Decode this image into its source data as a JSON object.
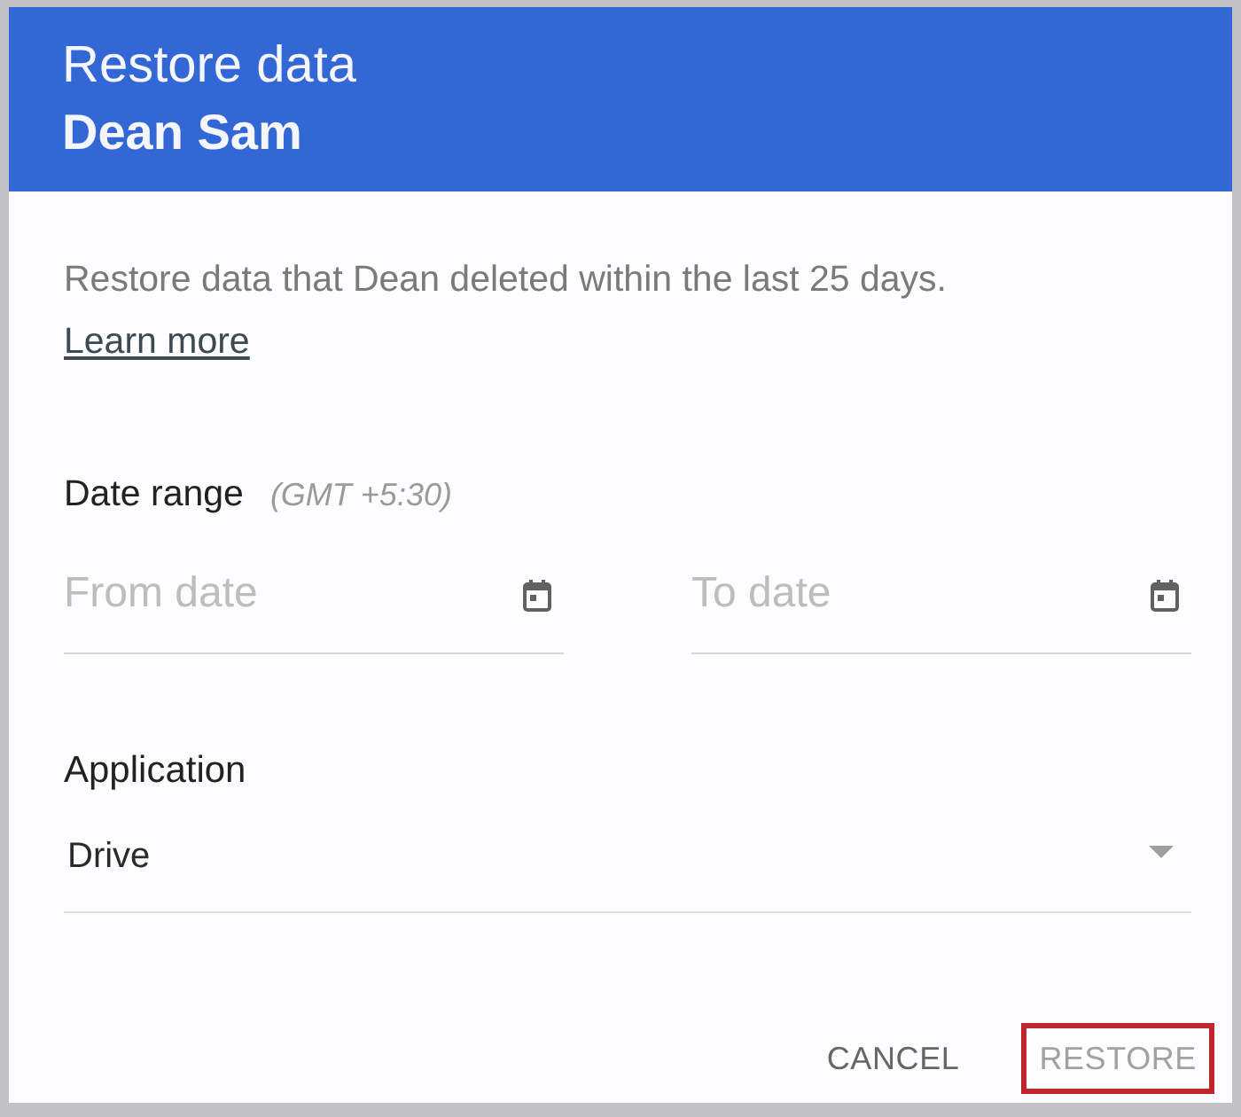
{
  "dialog": {
    "title": "Restore data",
    "subtitle": "Dean Sam"
  },
  "description": {
    "text": "Restore data that Dean deleted within the last 25 days.",
    "link": "Learn more"
  },
  "date_range": {
    "label": "Date range",
    "timezone": "(GMT +5:30)",
    "fields": [
      {
        "placeholder": "From date"
      },
      {
        "placeholder": "To date"
      }
    ]
  },
  "application": {
    "label": "Application",
    "value": "Drive"
  },
  "buttons": [
    {
      "label": "CANCEL",
      "disabled": false,
      "highlighted": false
    },
    {
      "label": "RESTORE",
      "disabled": true,
      "highlighted": true
    }
  ]
}
